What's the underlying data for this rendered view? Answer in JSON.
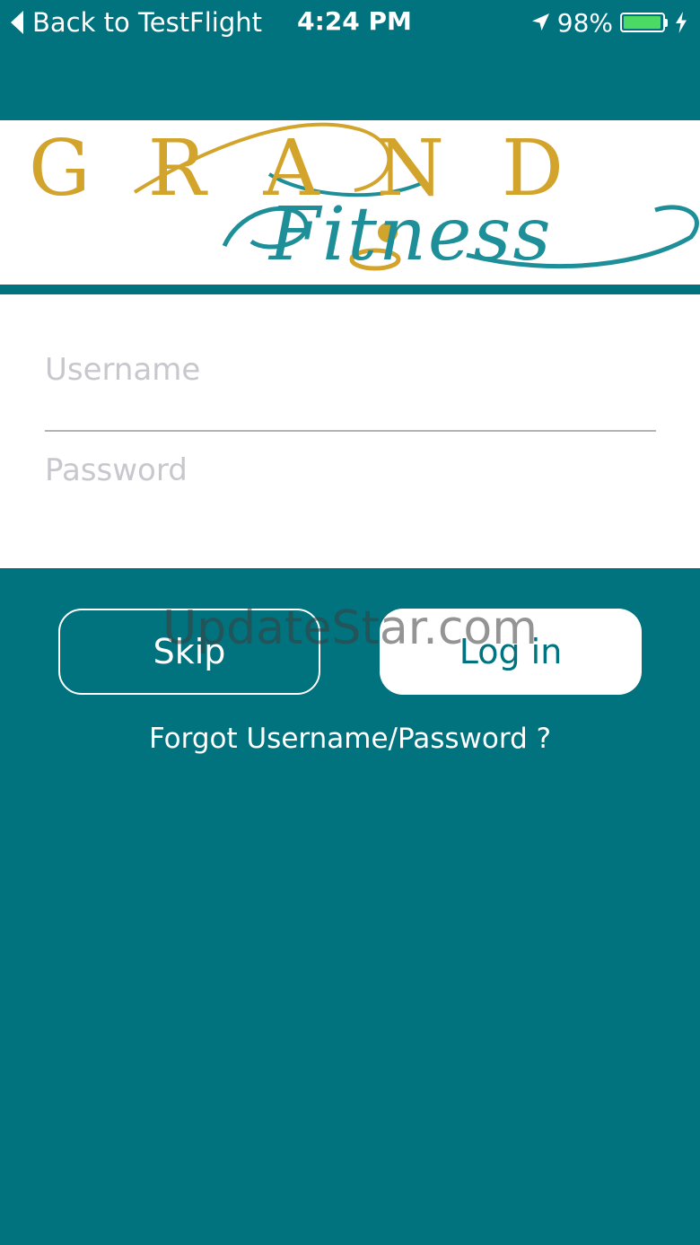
{
  "status_bar": {
    "back_label": "Back to TestFlight",
    "time": "4:24 PM",
    "battery_percent": "98%",
    "battery_level": 0.98,
    "icons": [
      "location-arrow-icon",
      "battery-icon",
      "charging-bolt-icon"
    ]
  },
  "logo": {
    "word_top": [
      "G",
      "R",
      "A",
      "N",
      "D"
    ],
    "word_bottom": "Fitness",
    "colors": {
      "gold": "#d3a42c",
      "teal": "#1e8f98"
    }
  },
  "form": {
    "username_placeholder": "Username",
    "password_placeholder": "Password",
    "username_value": "",
    "password_value": ""
  },
  "actions": {
    "skip_label": "Skip",
    "login_label": "Log in",
    "forgot_label": "Forgot Username/Password ?"
  },
  "watermark": "UpdateStar.com",
  "colors": {
    "background": "#00737f",
    "card": "#ffffff",
    "battery_fill": "#4cd964"
  }
}
